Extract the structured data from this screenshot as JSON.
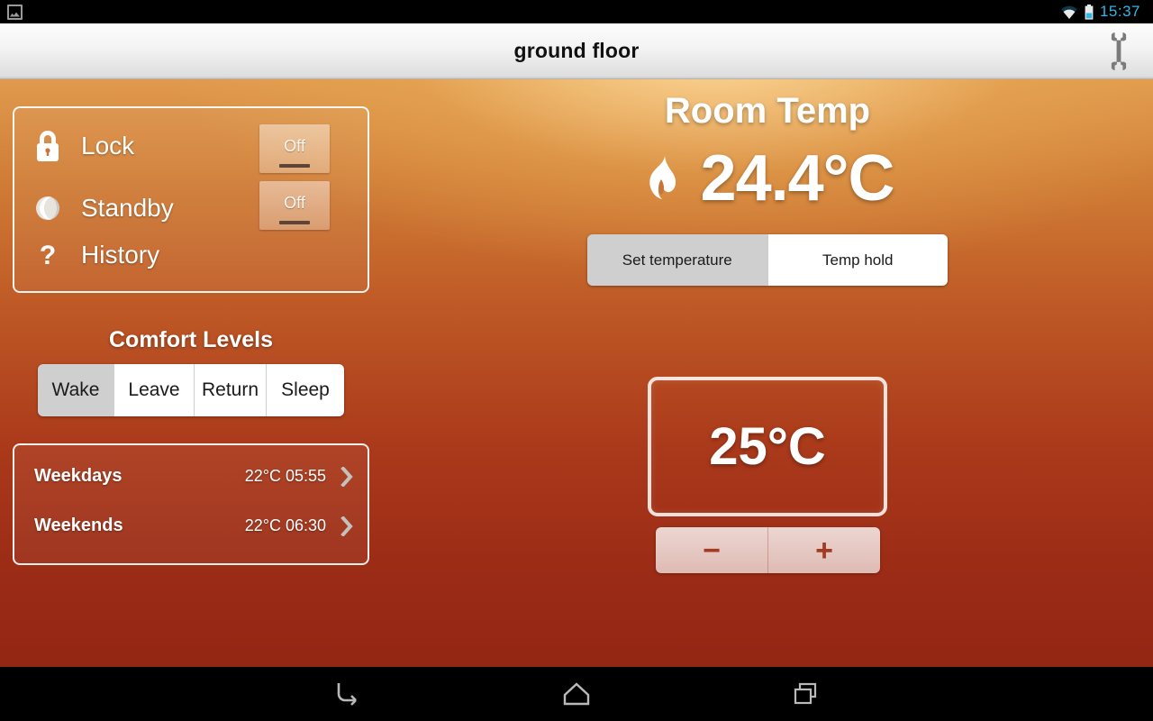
{
  "statusbar": {
    "notification_icon": "screenshot-icon",
    "wifi_icon": "wifi-icon",
    "battery_icon": "battery-icon",
    "clock": "15:37"
  },
  "titlebar": {
    "title": "ground floor",
    "settings_icon": "wrench-icon"
  },
  "controls": {
    "rows": [
      {
        "icon": "lock-icon",
        "label": "Lock",
        "toggle": "Off"
      },
      {
        "icon": "moon-icon",
        "label": "Standby",
        "toggle": "Off"
      },
      {
        "icon": "question-mark-icon",
        "label": "History"
      }
    ]
  },
  "comfort": {
    "title": "Comfort Levels",
    "tabs": [
      {
        "label": "Wake",
        "selected": true
      },
      {
        "label": "Leave",
        "selected": false
      },
      {
        "label": "Return",
        "selected": false
      },
      {
        "label": "Sleep",
        "selected": false
      }
    ]
  },
  "schedule": {
    "rows": [
      {
        "name": "Weekdays",
        "value": "22°C 05:55",
        "chevron": "chevron-right-icon"
      },
      {
        "name": "Weekends",
        "value": "22°C 06:30",
        "chevron": "chevron-right-icon"
      }
    ]
  },
  "room_temp": {
    "title": "Room Temp",
    "flame_icon": "flame-icon",
    "value": "24.4°C"
  },
  "mode": {
    "tabs": [
      {
        "label": "Set temperature",
        "selected": true
      },
      {
        "label": "Temp hold",
        "selected": false
      }
    ]
  },
  "target": {
    "value": "25°C",
    "decrease_label": "−",
    "increase_label": "+"
  },
  "navbar": {
    "back_icon": "back-icon",
    "home_icon": "home-icon",
    "recents_icon": "recents-icon"
  },
  "colors": {
    "accent_blue": "#33b5e5",
    "bg_top": "#e09a4e",
    "bg_bottom": "#932614",
    "selected_tab": "#cfcfcf",
    "step_glyph": "#a53a22"
  }
}
